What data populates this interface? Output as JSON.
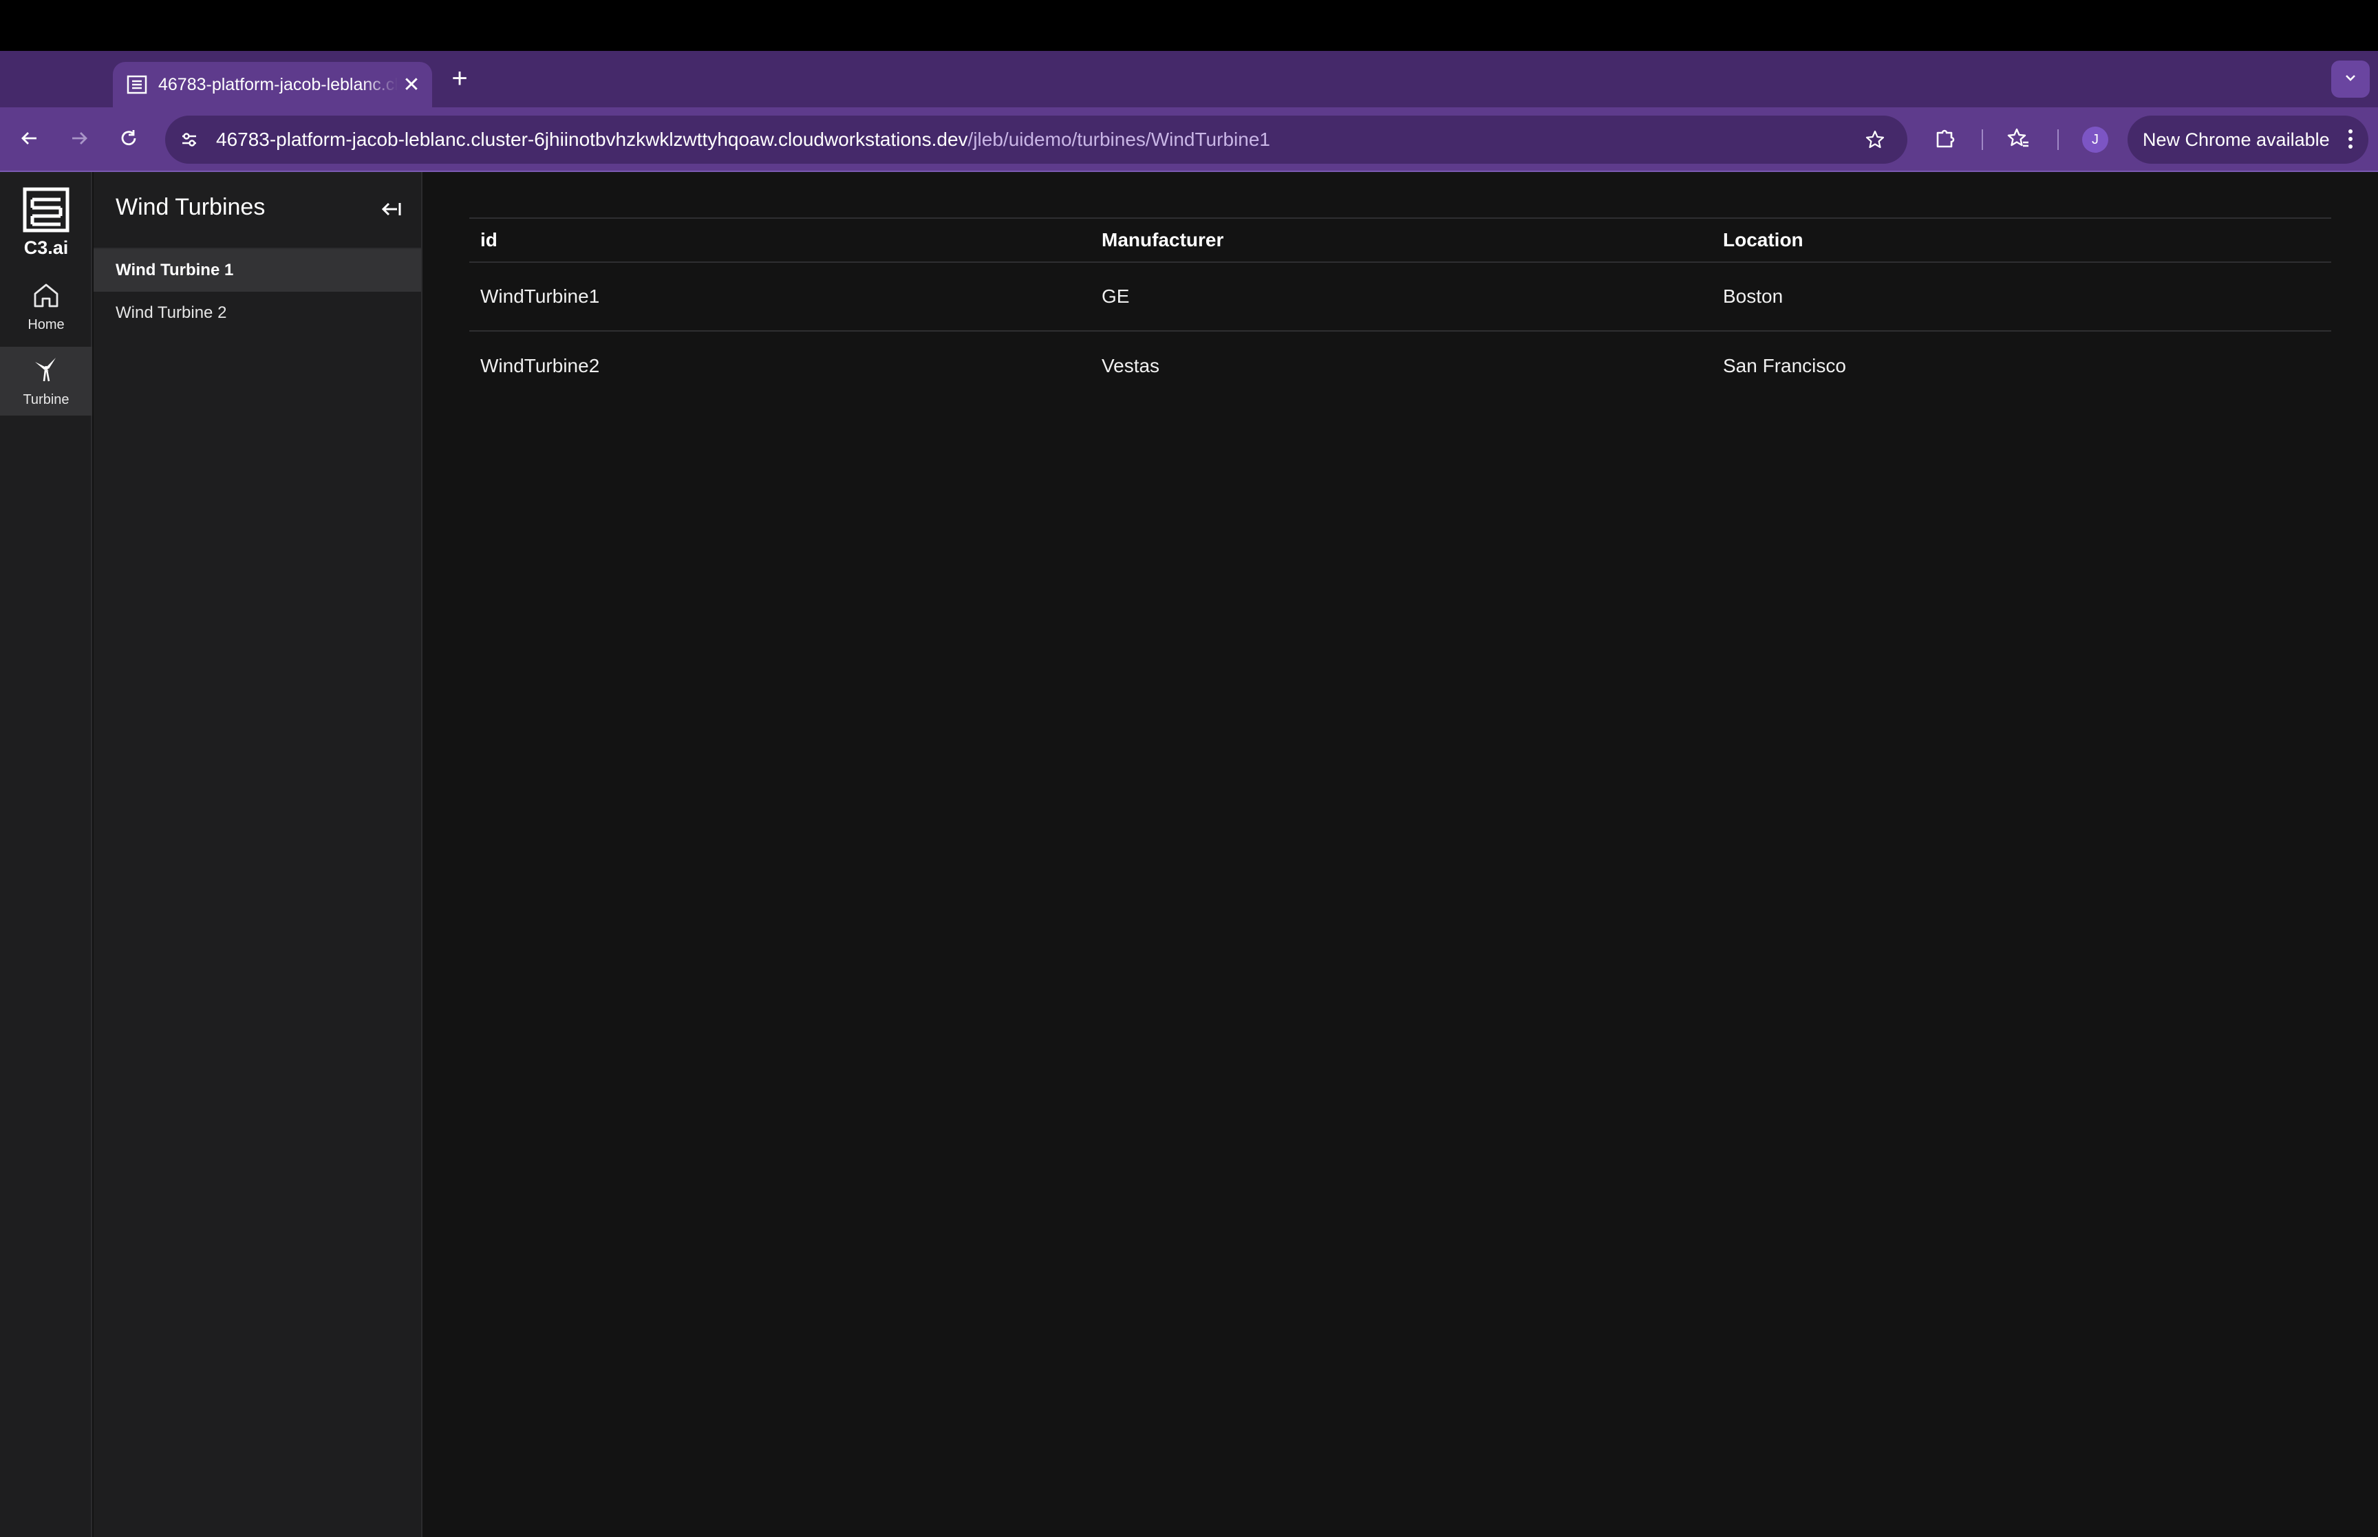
{
  "browser": {
    "tab": {
      "title": "46783-platform-jacob-leblanc.cluster-6jhiinotbvhzkwklzwttyhqoaw.cloudworkstations.dev",
      "close": "✕"
    },
    "new_tab": "+",
    "url": {
      "host": "46783-platform-jacob-leblanc.cluster-6jhiinotbvhzkwklzwttyhqoaw.cloudworkstations.dev",
      "path": "/jleb/uidemo/turbines/WindTurbine1"
    },
    "profile_initial": "J",
    "update_label": "New Chrome available",
    "accent": "#5e3b8c"
  },
  "rail": {
    "logo_text": "C3.ai",
    "items": [
      {
        "label": "Home",
        "icon": "home-icon"
      },
      {
        "label": "Turbine",
        "icon": "turbine-icon"
      }
    ]
  },
  "sidenav": {
    "title": "Wind Turbines",
    "items": [
      {
        "label": "Wind Turbine 1",
        "active": true
      },
      {
        "label": "Wind Turbine 2",
        "active": false
      }
    ]
  },
  "table": {
    "columns": [
      "id",
      "Manufacturer",
      "Location"
    ],
    "rows": [
      [
        "WindTurbine1",
        "GE",
        "Boston"
      ],
      [
        "WindTurbine2",
        "Vestas",
        "San Francisco"
      ]
    ]
  }
}
